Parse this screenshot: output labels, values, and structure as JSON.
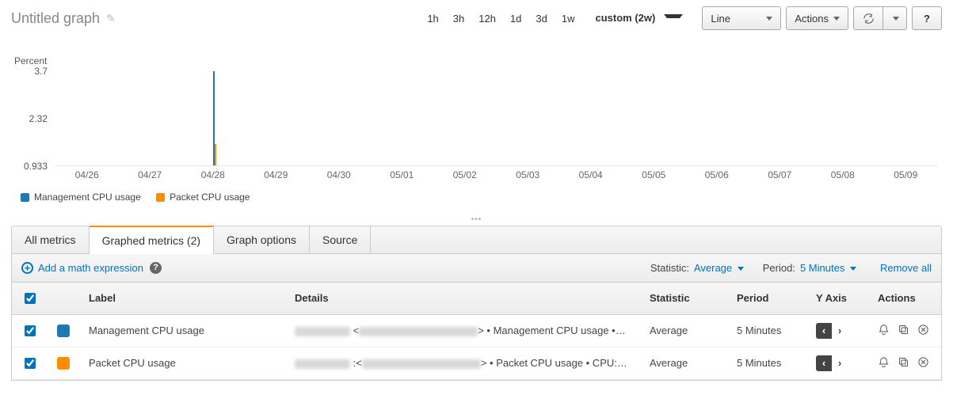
{
  "header": {
    "title": "Untitled graph",
    "time_options": [
      "1h",
      "3h",
      "12h",
      "1d",
      "3d",
      "1w"
    ],
    "custom_label": "custom (2w)",
    "chart_type": "Line",
    "actions_label": "Actions"
  },
  "chart_data": {
    "type": "line",
    "title": "",
    "ylabel": "Percent",
    "xlabel": "",
    "ylim": [
      0.933,
      3.7
    ],
    "yticks": [
      3.7,
      2.32,
      0.933
    ],
    "categories": [
      "04/26",
      "04/27",
      "04/28",
      "04/29",
      "04/30",
      "05/01",
      "05/02",
      "05/03",
      "05/04",
      "05/05",
      "05/06",
      "05/07",
      "05/08",
      "05/09"
    ],
    "series": [
      {
        "name": "Management CPU usage",
        "color": "#1f77b4",
        "spike_x_fraction": 0.179,
        "spike_value": 3.7
      },
      {
        "name": "Packet CPU usage",
        "color": "#ff8c00",
        "spike_x_fraction": 0.18,
        "spike_value": 1.57
      }
    ]
  },
  "tabs": {
    "all": "All metrics",
    "graphed": "Graphed metrics (2)",
    "options": "Graph options",
    "source": "Source"
  },
  "panel_toolbar": {
    "add_math": "Add a math expression",
    "statistic_label": "Statistic:",
    "statistic_value": "Average",
    "period_label": "Period:",
    "period_value": "5 Minutes",
    "remove_all": "Remove all"
  },
  "table": {
    "headers": {
      "label": "Label",
      "details": "Details",
      "statistic": "Statistic",
      "period": "Period",
      "yaxis": "Y Axis",
      "actions": "Actions"
    },
    "rows": [
      {
        "checked": true,
        "color": "#1f77b4",
        "label": "Management CPU usage",
        "details_suffix": "> • Management CPU usage •…",
        "statistic": "Average",
        "period": "5 Minutes"
      },
      {
        "checked": true,
        "color": "#ff8c00",
        "label": "Packet CPU usage",
        "details_suffix": "> • Packet CPU usage • CPU:…",
        "statistic": "Average",
        "period": "5 Minutes"
      }
    ]
  }
}
